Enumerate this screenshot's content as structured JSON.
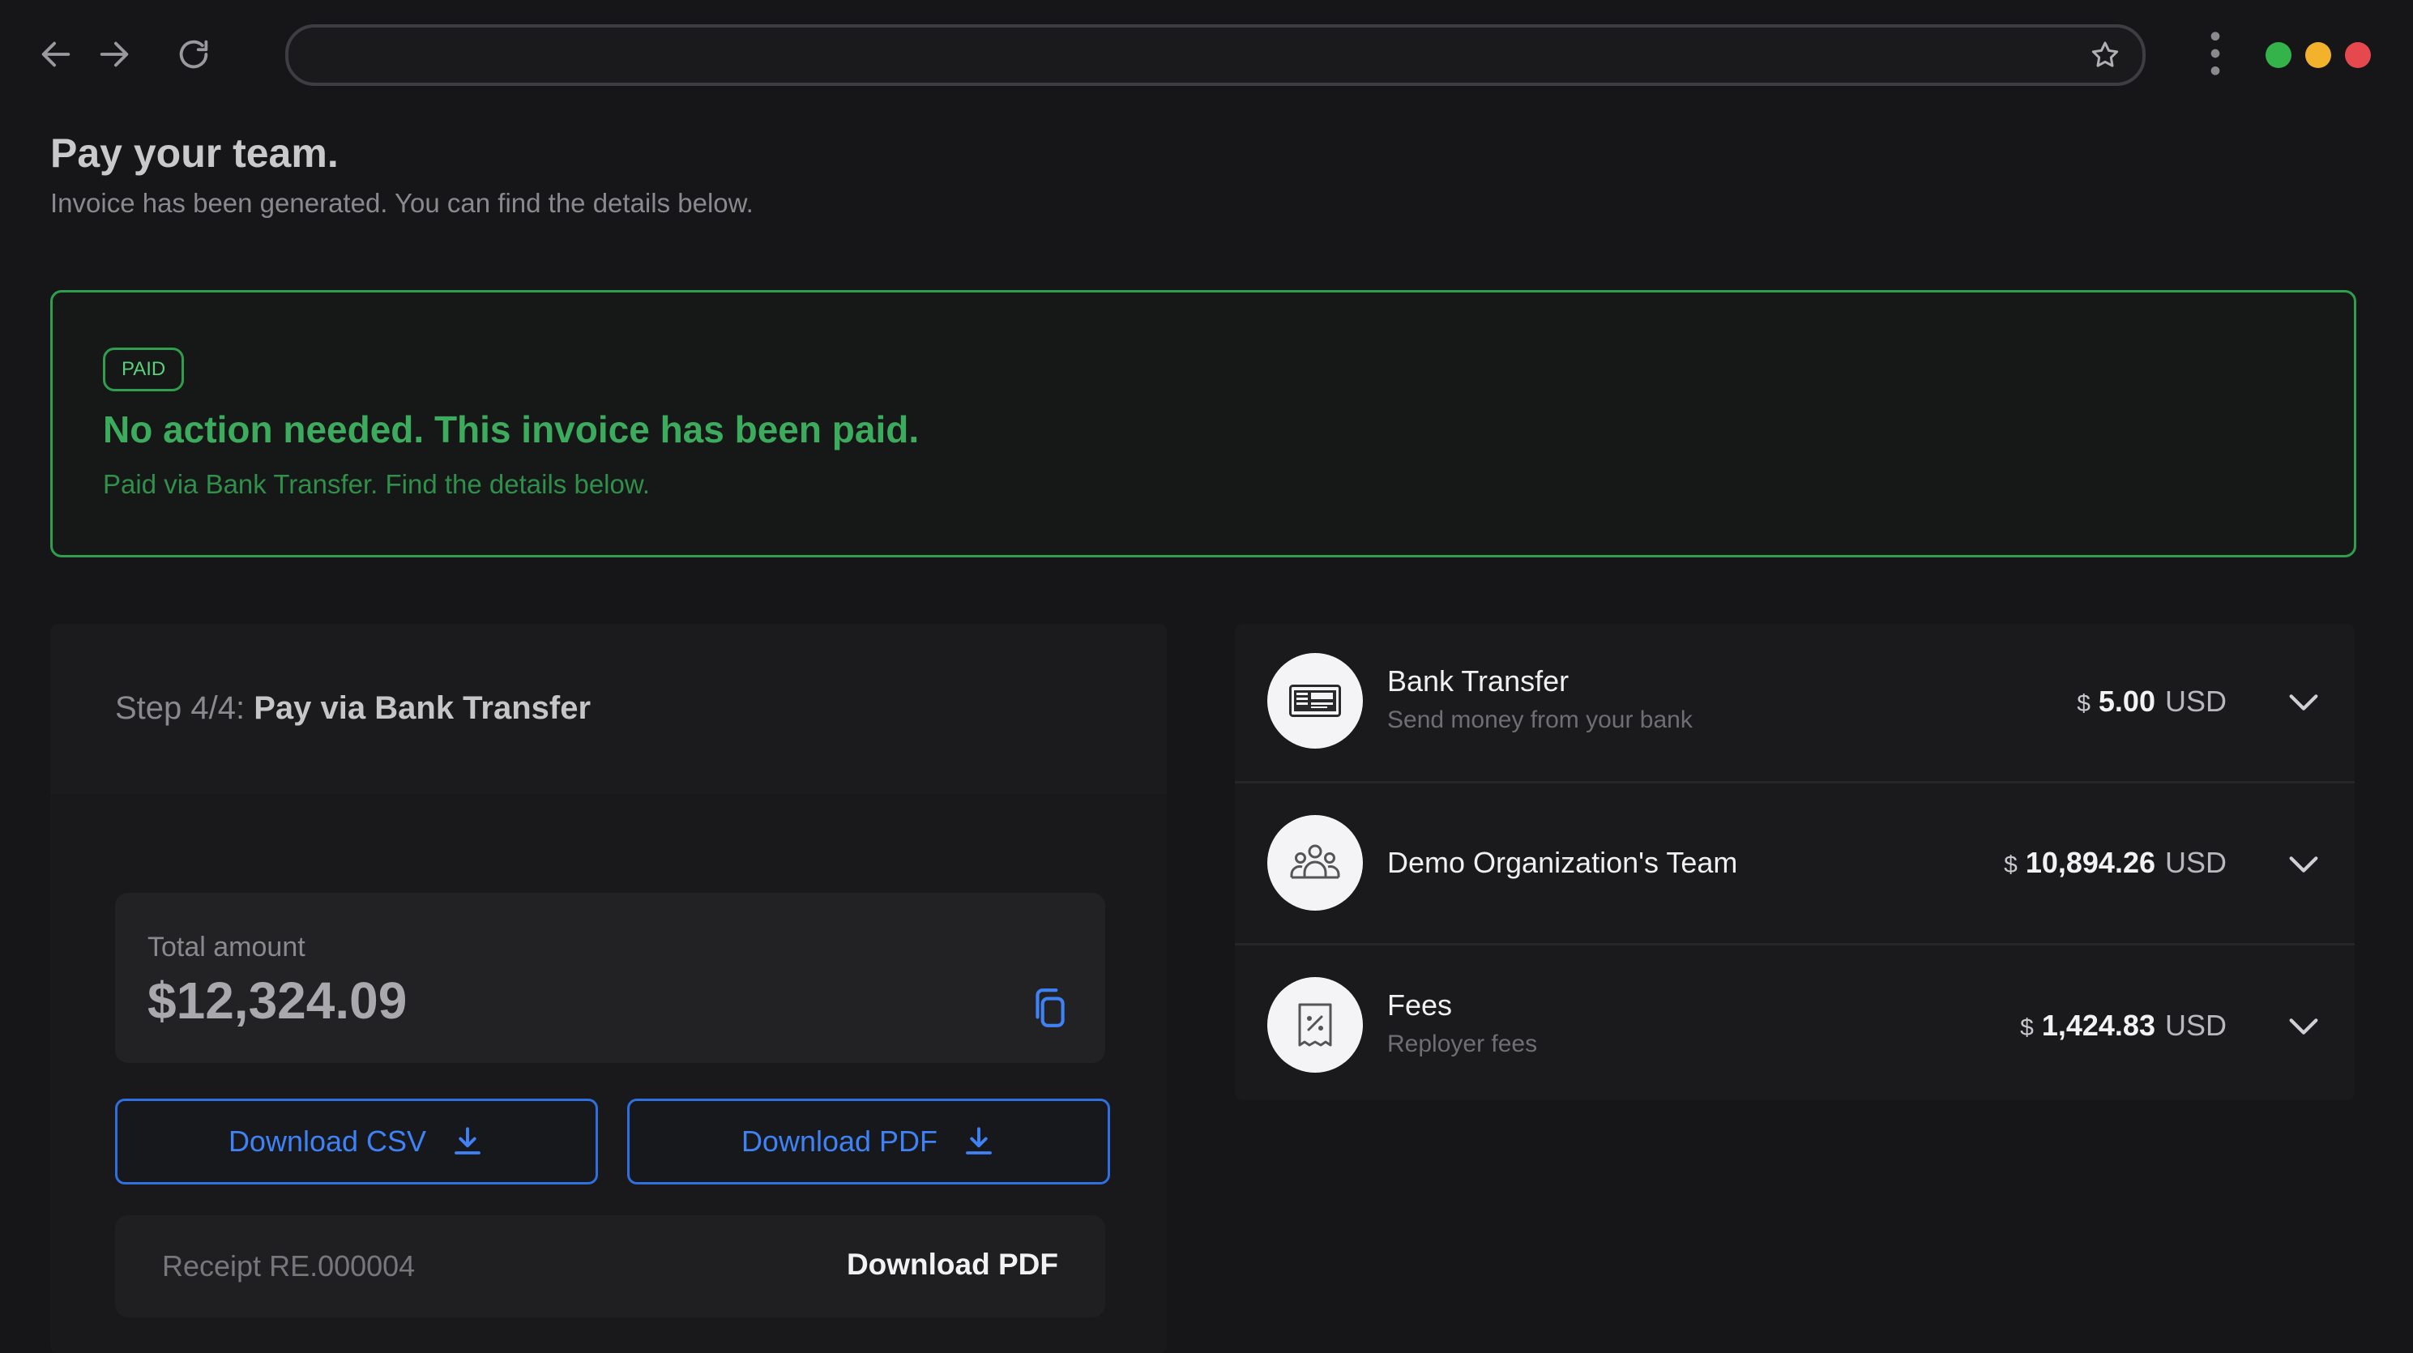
{
  "browser": {
    "url": "",
    "dots": [
      "#33b34a",
      "#f2b22c",
      "#e5484d"
    ]
  },
  "page": {
    "title": "Pay your team.",
    "subtitle": "Invoice has been generated. You can find the details below."
  },
  "banner": {
    "badge": "PAID",
    "title": "No action needed. This invoice has been paid.",
    "subtitle": "Paid via Bank Transfer. Find the details below."
  },
  "step": {
    "prefix": "Step 4/4:",
    "name": "Pay via Bank Transfer"
  },
  "total": {
    "label": "Total amount",
    "value": "$12,324.09"
  },
  "buttons": {
    "download_csv": "Download CSV",
    "download_pdf": "Download PDF"
  },
  "receipt": {
    "label": "Receipt RE.000004",
    "action": "Download PDF"
  },
  "breakdown": [
    {
      "title": "Bank Transfer",
      "subtitle": "Send money from your bank",
      "currency_symbol": "$",
      "amount": "5.00",
      "currency": "USD",
      "icon": "bank-transfer-icon"
    },
    {
      "title": "Demo Organization's Team",
      "subtitle": "",
      "currency_symbol": "$",
      "amount": "10,894.26",
      "currency": "USD",
      "icon": "team-icon"
    },
    {
      "title": "Fees",
      "subtitle": "Reployer fees",
      "currency_symbol": "$",
      "amount": "1,424.83",
      "currency": "USD",
      "icon": "receipt-percent-icon"
    }
  ],
  "colors": {
    "accent_blue": "#3f82f5",
    "paid_green": "#3dab5e"
  }
}
